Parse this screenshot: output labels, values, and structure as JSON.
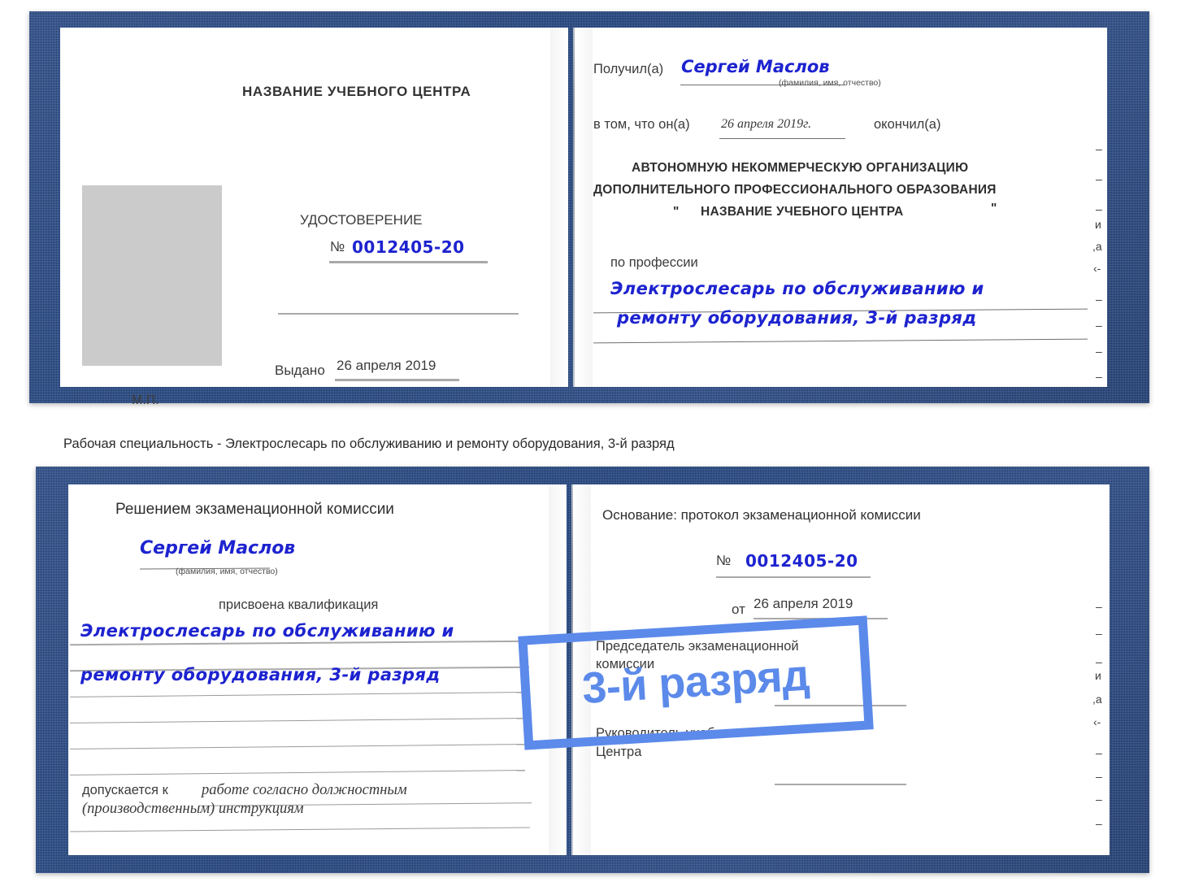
{
  "meta": {
    "accent_blue": "#5c8aea",
    "ink_blue": "#1d23cf",
    "cover_blue": "#224a88",
    "photo_gray": "#cbcbcb"
  },
  "caption": {
    "text": "Рабочая специальность - Электрослесарь по обслуживанию и ремонту оборудования, 3-й разряд"
  },
  "badge": {
    "label": "3-й разряд"
  },
  "top_certificate": {
    "left_page": {
      "title": "НАЗВАНИЕ УЧЕБНОГО ЦЕНТРА",
      "doc_kind": "УДОСТОВЕРЕНИЕ",
      "number_symbol": "№",
      "number_value": "0012405-20",
      "issued_label": "Выдано",
      "issued_value": "26 апреля 2019",
      "seal_label": "М.П."
    },
    "right_page": {
      "received_label": "Получил(а)",
      "received_value": "Сергей Маслов",
      "fio_hint": "(фамилия, имя, отчество)",
      "that_he_label": "в том, что он(а)",
      "completion_date": "26 апреля 2019г.",
      "finished_label": "окончил(а)",
      "org_line1": "АВТОНОМНУЮ НЕКОММЕРЧЕСКУЮ ОРГАНИЗАЦИЮ",
      "org_line2": "ДОПОЛНИТЕЛЬНОГО ПРОФЕССИОНАЛЬНОГО ОБРАЗОВАНИЯ",
      "org_quote_open": "\"",
      "org_name": "НАЗВАНИЕ УЧЕБНОГО ЦЕНТРА",
      "org_quote_close": "\"",
      "profession_label": "по профессии",
      "profession_line1": "Электрослесарь по обслуживанию и",
      "profession_line2": "ремонту оборудования, 3-й разряд"
    },
    "edge_fragments": [
      "–",
      "–",
      "–",
      "и",
      ",а",
      "‹-",
      "–",
      "–",
      "–",
      "–"
    ]
  },
  "bottom_certificate": {
    "left_page": {
      "title": "Решением экзаменационной комиссии",
      "name_value": "Сергей Маслов",
      "fio_hint": "(фамилия, имя, отчество)",
      "qualification_label": "присвоена квалификация",
      "qualification_line1": "Электрослесарь по обслуживанию и",
      "qualification_line2": "ремонту оборудования, 3-й разряд",
      "allowed_label": "допускается к",
      "allowed_value_line1": "работе согласно должностным",
      "allowed_value_line2": "(производственным) инструкциям"
    },
    "right_page": {
      "basis_label": "Основание: протокол экзаменационной комиссии",
      "number_symbol": "№",
      "number_value": "0012405-20",
      "date_label": "от",
      "date_value": "26 апреля 2019",
      "chairman_line1": "Председатель экзаменационной",
      "chairman_line2": "комиссии",
      "head_line1": "Руководитель учебного",
      "head_line2": "Центра"
    },
    "edge_fragments": [
      "–",
      "–",
      "–",
      "и",
      ",а",
      "‹-",
      "–",
      "–",
      "–",
      "–"
    ]
  }
}
